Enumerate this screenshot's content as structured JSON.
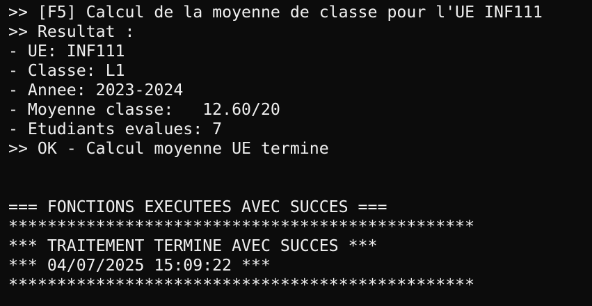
{
  "terminal": {
    "lines": [
      ">> [F5] Calcul de la moyenne de classe pour l'UE INF111",
      ">> Resultat :",
      "- UE: INF111",
      "- Classe: L1",
      "- Annee: 2023-2024",
      "- Moyenne classe:   12.60/20",
      "- Etudiants evalues: 7",
      ">> OK - Calcul moyenne UE termine",
      "",
      "",
      "=== FONCTIONS EXECUTEES AVEC SUCCES ===",
      "************************************************",
      "*** TRAITEMENT TERMINE AVEC SUCCES ***",
      "*** 04/07/2025 15:09:22 ***",
      "************************************************"
    ]
  }
}
